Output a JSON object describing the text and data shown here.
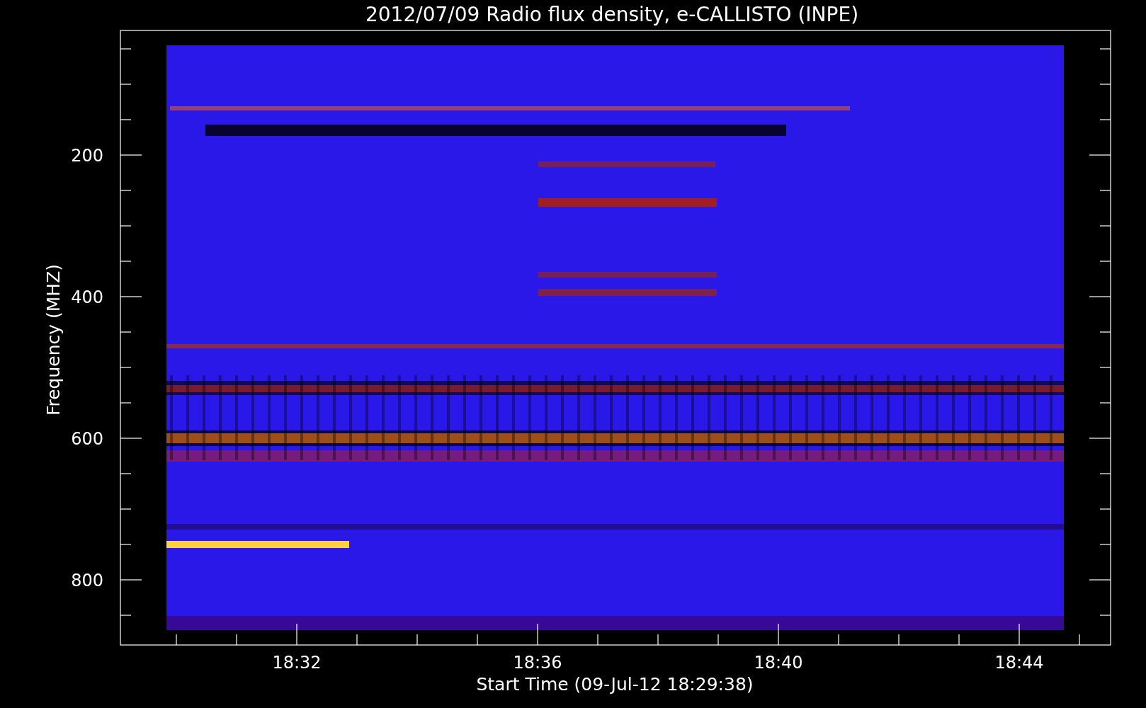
{
  "title": "2012/07/09  Radio flux density, e-CALLISTO (INPE)",
  "y_axis": {
    "label": "Frequency (MHZ)",
    "ticks": [
      "200",
      "400",
      "600",
      "800"
    ]
  },
  "x_axis": {
    "label": "Start Time (09-Jul-12 18:29:38)",
    "ticks": [
      "18:32",
      "18:36",
      "18:40",
      "18:44"
    ]
  }
}
